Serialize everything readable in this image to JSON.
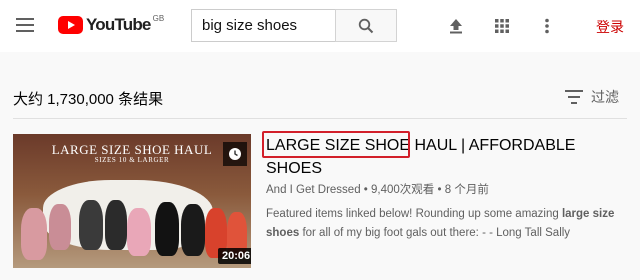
{
  "header": {
    "logo_text": "YouTube",
    "region": "GB",
    "search_value": "big size shoes",
    "login_label": "登录",
    "colors": {
      "brand": "#ff0000",
      "login": "#cc0000"
    },
    "icons": [
      "menu-icon",
      "search-icon",
      "upload-icon",
      "apps-icon",
      "more-icon"
    ]
  },
  "results": {
    "count_text": "大约 1,730,000 条结果",
    "filter_label": "过滤"
  },
  "video": {
    "thumbnail_title": "LARGE SIZE SHOE HAUL",
    "thumbnail_subtitle": "SIZES 10 & LARGER",
    "duration": "20:06",
    "title_highlight": "LARGE SIZE SHOE",
    "title_rest": " HAUL | AFFORDABLE SHOES",
    "channel": "And I Get Dressed",
    "views": "9,400次观看",
    "age": "8 个月前",
    "meta_separator": " • ",
    "desc_part1": "Featured items linked below! Rounding up some amazing ",
    "desc_bold1": "large size shoes",
    "desc_part2": " for all of my big foot gals out there: - - Long Tall Sally"
  }
}
